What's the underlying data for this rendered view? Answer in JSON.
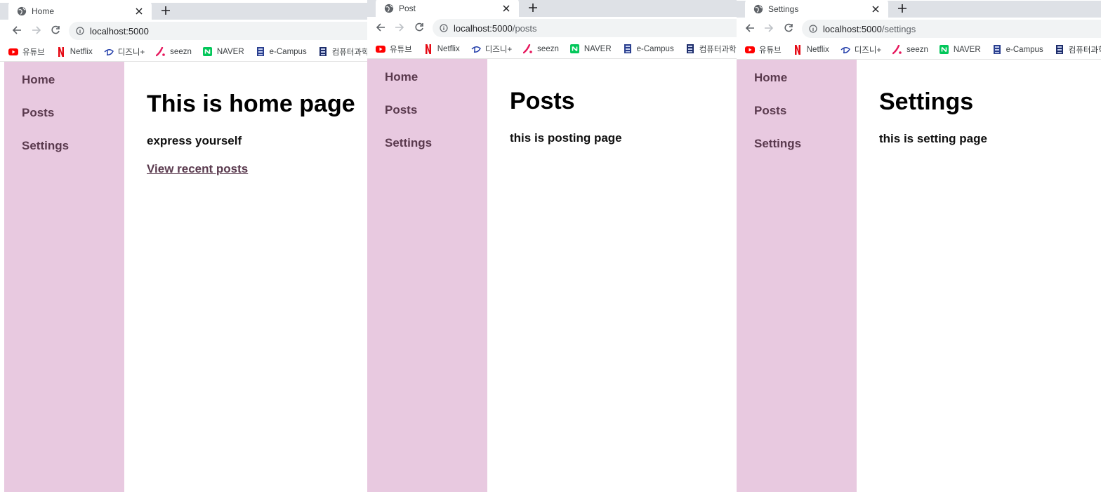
{
  "bookmarks": [
    {
      "label": "유튜브",
      "icon": "youtube-icon"
    },
    {
      "label": "Netflix",
      "icon": "netflix-icon"
    },
    {
      "label": "디즈니+",
      "icon": "disney-plus-icon"
    },
    {
      "label": "seezn",
      "icon": "seezn-icon"
    },
    {
      "label": "NAVER",
      "icon": "naver-icon"
    },
    {
      "label": "e-Campus",
      "icon": "ecampus-icon"
    },
    {
      "label": "컴퓨터과학과",
      "icon": "university-icon"
    }
  ],
  "sidebar": {
    "items": [
      {
        "label": "Home"
      },
      {
        "label": "Posts"
      },
      {
        "label": "Settings"
      }
    ]
  },
  "windows": {
    "home": {
      "tab_title": "Home",
      "url_host": "localhost:5000",
      "url_path": "",
      "heading": "This is home page",
      "subtitle": "express yourself",
      "link": "View recent posts"
    },
    "posts": {
      "tab_title": "Post",
      "url_host": "localhost:5000",
      "url_path": "/posts",
      "heading": "Posts",
      "subtitle": "this is posting page"
    },
    "settings": {
      "tab_title": "Settings",
      "url_host": "localhost:5000",
      "url_path": "/settings",
      "heading": "Settings",
      "subtitle": "this is setting page"
    }
  },
  "colors": {
    "sidebar_bg": "#e8c9e0",
    "link": "#5a3a4e",
    "tabstrip": "#dee1e6",
    "omnibox": "#f1f3f4"
  }
}
